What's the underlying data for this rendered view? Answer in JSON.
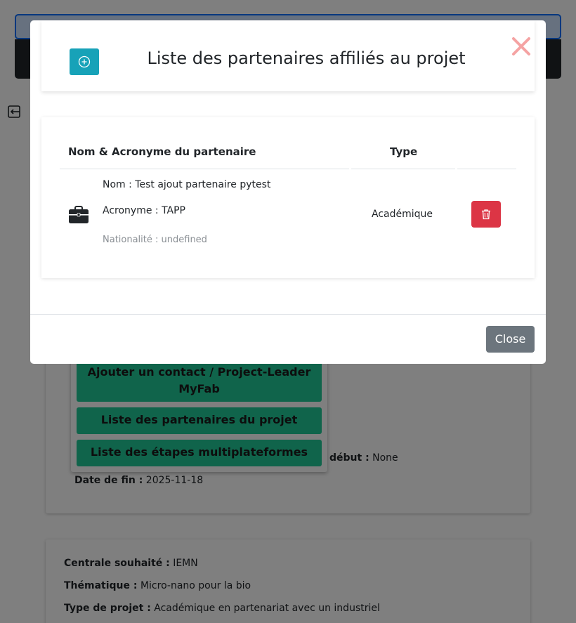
{
  "modal": {
    "title": "Liste des partenaires affiliés au projet",
    "table": {
      "headers": {
        "name": "Nom & Acronyme du partenaire",
        "type": "Type"
      },
      "rows": [
        {
          "nom": "Nom : Test ajout partenaire pytest",
          "acronyme": "Acronyme : TAPP",
          "nationalite": "Nationalité : undefined",
          "type": "Académique"
        }
      ]
    },
    "close_label": "Close"
  },
  "background": {
    "dropdown": {
      "item_contact": "Ajouter un contact / Project-Leader MyFab",
      "item_partners": "Liste des partenaires du projet",
      "item_steps": "Liste des étapes multiplateformes"
    },
    "details": {
      "debut_label": "début :",
      "debut_value": "None",
      "fin_label": "Date de fin :",
      "fin_value": "2025-11-18",
      "centrale_label": "Centrale souhaité :",
      "centrale_value": "IEMN",
      "thematique_label": "Thématique :",
      "thematique_value": "Micro-nano pour la bio",
      "type_label": "Type de projet :",
      "type_value": "Académique en partenariat avec un industriel"
    }
  },
  "colors": {
    "add_button": "#17a2b8",
    "delete_button": "#dc3545",
    "close_button": "#6c757d",
    "close_x": "#f5a3a3",
    "dropdown_buttons": "#20c997"
  }
}
